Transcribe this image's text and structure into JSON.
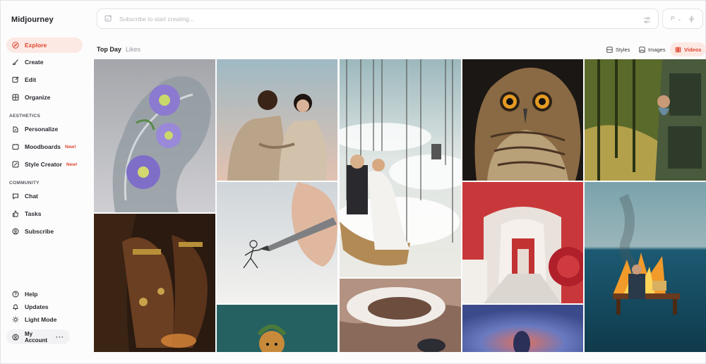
{
  "app": {
    "name": "Midjourney"
  },
  "sidebar": {
    "items": [
      {
        "label": "Explore",
        "icon": "compass-icon"
      },
      {
        "label": "Create",
        "icon": "brush-icon"
      },
      {
        "label": "Edit",
        "icon": "edit-icon"
      },
      {
        "label": "Organize",
        "icon": "grid-icon"
      }
    ],
    "aesthetics_label": "AESTHETICS",
    "aesthetics": [
      {
        "label": "Personalize",
        "icon": "personalize-icon"
      },
      {
        "label": "Moodboards",
        "icon": "moodboard-icon",
        "badge": "New!"
      },
      {
        "label": "Style Creator",
        "icon": "palette-icon",
        "badge": "New!"
      }
    ],
    "community_label": "COMMUNITY",
    "community": [
      {
        "label": "Chat",
        "icon": "chat-icon"
      },
      {
        "label": "Tasks",
        "icon": "thumbs-up-icon"
      },
      {
        "label": "Subscribe",
        "icon": "subscribe-icon"
      }
    ],
    "footer": [
      {
        "label": "Help",
        "icon": "help-icon"
      },
      {
        "label": "Updates",
        "icon": "bell-icon"
      },
      {
        "label": "Light Mode",
        "icon": "sun-icon"
      }
    ],
    "account": {
      "label": "My Account",
      "menu": "···"
    }
  },
  "search": {
    "placeholder": "Subscribe to start creating..."
  },
  "profile_box": {
    "label": "P",
    "chevron": "⌄"
  },
  "tabs": [
    {
      "label": "Top Day"
    },
    {
      "label": "Likes"
    }
  ],
  "filters": [
    {
      "label": "Styles",
      "icon": "styles-icon"
    },
    {
      "label": "Images",
      "icon": "image-icon"
    },
    {
      "label": "Videos",
      "icon": "video-icon"
    }
  ],
  "colors": {
    "accent": "#e0452f",
    "accent_bg": "#fde9e4"
  },
  "gallery": [
    {
      "name": "glass-flower-sculpture"
    },
    {
      "name": "couple-portrait"
    },
    {
      "name": "swings-over-clouds"
    },
    {
      "name": "owl-closeup"
    },
    {
      "name": "train-window-forest"
    },
    {
      "name": "hands-with-rings"
    },
    {
      "name": "pencil-drawing-figure"
    },
    {
      "name": "red-corridor-interior"
    },
    {
      "name": "burning-desk-in-sea"
    },
    {
      "name": "teal-portrait"
    },
    {
      "name": "white-swirl-closeup"
    },
    {
      "name": "blue-silhouette"
    }
  ]
}
